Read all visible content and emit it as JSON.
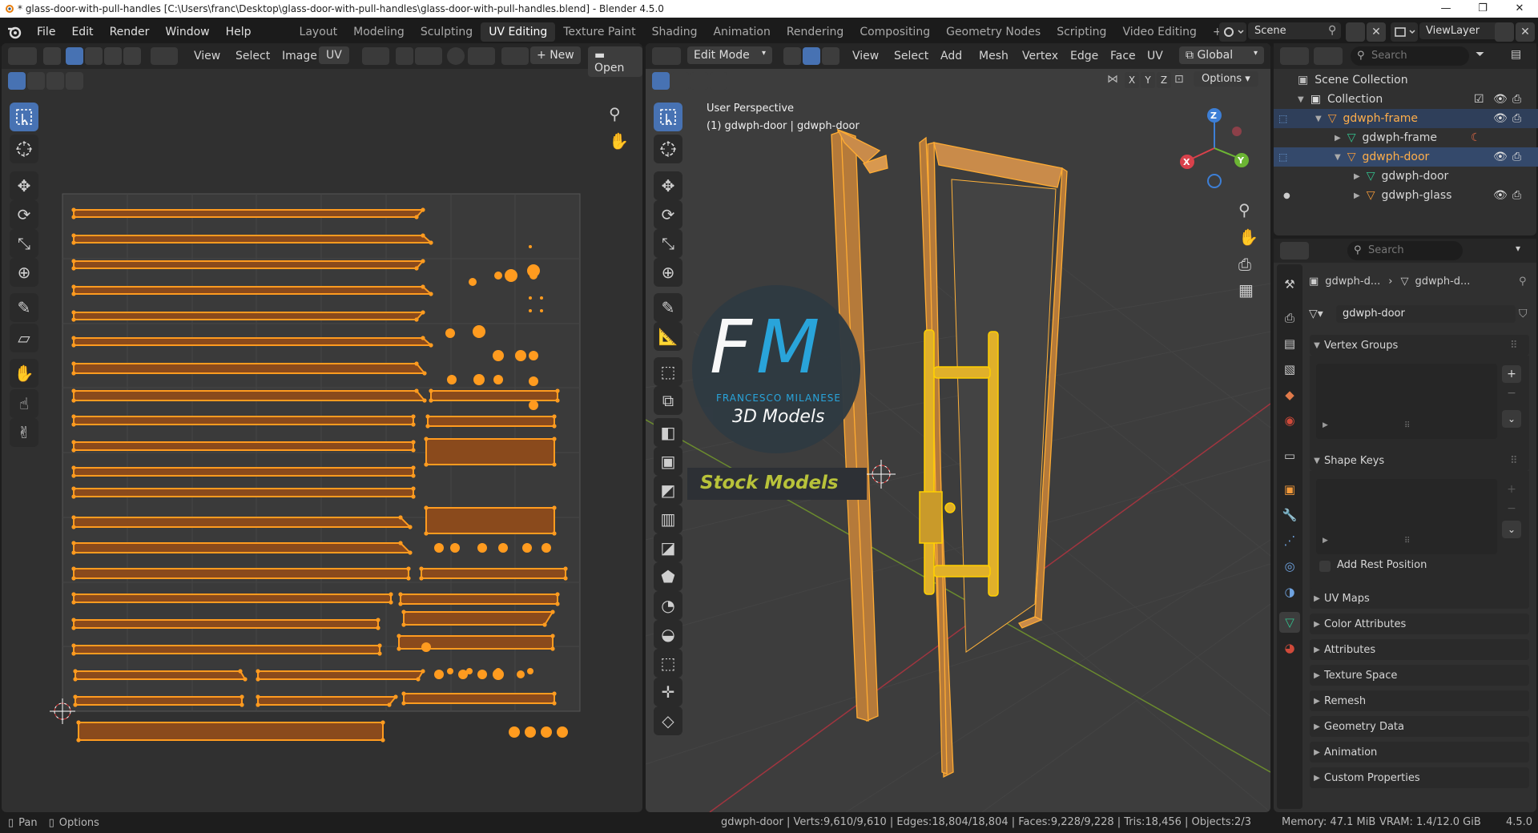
{
  "window": {
    "title": "* glass-door-with-pull-handles [C:\\Users\\franc\\Desktop\\glass-door-with-pull-handles\\glass-door-with-pull-handles.blend] - Blender 4.5.0",
    "controls": [
      "—",
      "❐",
      "✕"
    ]
  },
  "menubar": {
    "items": [
      "File",
      "Edit",
      "Render",
      "Window",
      "Help"
    ],
    "workspaces": [
      "Layout",
      "Modeling",
      "Sculpting",
      "UV Editing",
      "Texture Paint",
      "Shading",
      "Animation",
      "Rendering",
      "Compositing",
      "Geometry Nodes",
      "Scripting",
      "Video Editing"
    ],
    "active_workspace": "UV Editing",
    "add_tab": "+",
    "scene_label": "Scene",
    "viewlayer_label": "ViewLayer"
  },
  "uv_editor": {
    "header_menus": [
      "View",
      "Select",
      "Image",
      "UV"
    ],
    "new_label": "New",
    "open_label": "Open"
  },
  "viewport": {
    "mode": "Edit Mode",
    "header_menus": [
      "View",
      "Select",
      "Add",
      "Mesh",
      "Vertex",
      "Edge",
      "Face",
      "UV"
    ],
    "orientation": "Global",
    "options_label": "Options",
    "axes": [
      "X",
      "Y",
      "Z"
    ],
    "info_line1": "User Perspective",
    "info_line2": "(1) gdwph-door | gdwph-door",
    "gizmo_labels": {
      "x": "X",
      "y": "Y",
      "z": "Z"
    },
    "logo": {
      "letters": "FM",
      "brand": "FRANCESCO MILANESE",
      "sub": "3D Models",
      "tagline": "Stock Models",
      "colors": {
        "F": "#ffffff",
        "M": "#29a8e0",
        "tag": "#b8c23a"
      }
    }
  },
  "outliner": {
    "search_placeholder": "Search",
    "items": [
      {
        "label": "Scene Collection",
        "type": "scene"
      },
      {
        "label": "Collection",
        "type": "collection"
      },
      {
        "label": "gdwph-frame",
        "type": "object"
      },
      {
        "label": "gdwph-frame",
        "type": "mesh"
      },
      {
        "label": "gdwph-door",
        "type": "object"
      },
      {
        "label": "gdwph-door",
        "type": "mesh"
      },
      {
        "label": "gdwph-glass",
        "type": "object"
      }
    ]
  },
  "properties": {
    "search_placeholder": "Search",
    "breadcrumb": [
      "gdwph-d...",
      "gdwph-d..."
    ],
    "mesh_name": "gdwph-door",
    "panels": {
      "vertex_groups": "Vertex Groups",
      "shape_keys": "Shape Keys",
      "add_rest_position": "Add Rest Position",
      "collapsed": [
        "UV Maps",
        "Color Attributes",
        "Attributes",
        "Texture Space",
        "Remesh",
        "Geometry Data",
        "Animation",
        "Custom Properties"
      ]
    }
  },
  "statusbar": {
    "pan": "Pan",
    "options": "Options",
    "stats": "gdwph-door | Verts:9,610/9,610 | Edges:18,804/18,804 | Faces:9,228/9,228 | Tris:18,456 | Objects:2/3",
    "memory": "Memory: 47.1 MiB",
    "vram": "VRAM: 1.4/12.0 GiB",
    "version": "4.5.0"
  },
  "colors": {
    "accent": "#4772b3",
    "selection": "#ff9b1f",
    "uv_fill": "#8a4a1c"
  }
}
